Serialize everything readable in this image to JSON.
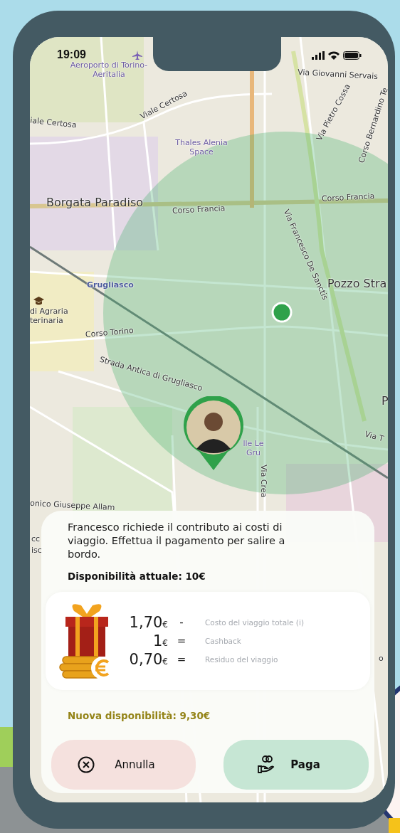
{
  "status_bar": {
    "time": "19:09"
  },
  "map": {
    "labels": [
      {
        "text": "Aeroporto di Torino-Aeritalia",
        "kind": "poi"
      },
      {
        "text": "Via Giovanni Servais",
        "kind": "street"
      },
      {
        "text": "Viale Certosa",
        "kind": "street"
      },
      {
        "text": "iale Certosa",
        "kind": "street"
      },
      {
        "text": "Thales Alenia Space",
        "kind": "poi"
      },
      {
        "text": "Via Pietro Cossa",
        "kind": "street"
      },
      {
        "text": "Corso Bernardino Te",
        "kind": "street"
      },
      {
        "text": "Borgata Paradiso",
        "kind": "district"
      },
      {
        "text": "Corso Francia",
        "kind": "street"
      },
      {
        "text": "Corso Francia",
        "kind": "street"
      },
      {
        "text": "Via Francesco De Sanctis",
        "kind": "street"
      },
      {
        "text": "Pozzo Stra",
        "kind": "district"
      },
      {
        "text": "Grugliasco",
        "kind": "town"
      },
      {
        "text": "di Agraria terinaria",
        "kind": "street"
      },
      {
        "text": "Corso Torino",
        "kind": "street"
      },
      {
        "text": "Strada Antica di Grugliasco",
        "kind": "street"
      },
      {
        "text": "lle Le Gru",
        "kind": "poi"
      },
      {
        "text": "Via Crea",
        "kind": "street"
      },
      {
        "text": "onico Giuseppe Allam",
        "kind": "street"
      },
      {
        "text": "P",
        "kind": "district"
      },
      {
        "text": "Via T",
        "kind": "street"
      },
      {
        "text": "cc",
        "kind": "street"
      },
      {
        "text": "isc",
        "kind": "street"
      },
      {
        "text": "o",
        "kind": "street"
      }
    ]
  },
  "payment": {
    "message": "Francesco richiede il contributo ai costi di viaggio. Effettua il pagamento per salire a bordo.",
    "current_balance": "Disponibilità attuale: 10€",
    "breakdown": [
      {
        "amount": "1,70",
        "currency": "€",
        "operator": "-",
        "description": "Costo del viaggio totale (i)"
      },
      {
        "amount": "1",
        "currency": "€",
        "operator": "=",
        "description": "Cashback"
      },
      {
        "amount": "0,70",
        "currency": "€",
        "operator": "=",
        "description": "Residuo del viaggio"
      }
    ],
    "new_balance": "Nuova disponibilità: 9,30€",
    "buttons": [
      {
        "label": "Annulla",
        "kind": "cancel"
      },
      {
        "label": "Paga",
        "kind": "pay"
      }
    ]
  }
}
